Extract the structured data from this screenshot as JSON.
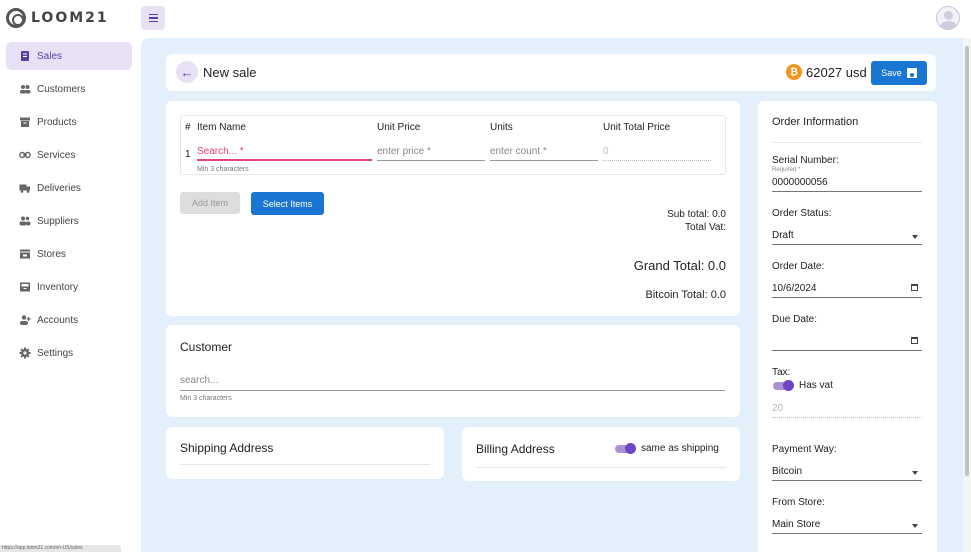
{
  "app": {
    "logo_text": "LOOM21"
  },
  "sidebar": {
    "items": [
      {
        "label": "Sales",
        "icon": "receipt-icon"
      },
      {
        "label": "Customers",
        "icon": "people-icon"
      },
      {
        "label": "Products",
        "icon": "archive-icon"
      },
      {
        "label": "Services",
        "icon": "link-icon"
      },
      {
        "label": "Deliveries",
        "icon": "truck-icon"
      },
      {
        "label": "Suppliers",
        "icon": "group-icon"
      },
      {
        "label": "Stores",
        "icon": "store-icon"
      },
      {
        "label": "Inventory",
        "icon": "inventory-icon"
      },
      {
        "label": "Accounts",
        "icon": "add-person-icon"
      },
      {
        "label": "Settings",
        "icon": "gear-icon"
      }
    ],
    "active": "Sales"
  },
  "status_url": "https://app.loom21.com/en-US/sales",
  "header": {
    "title": "New sale",
    "btc_price": "62027 usd",
    "save_label": "Save"
  },
  "items_table": {
    "columns": [
      "#",
      "Item Name",
      "Unit Price",
      "Units",
      "Unit Total Price"
    ],
    "row_number": "1",
    "item_placeholder": "Search... *",
    "item_helper": "Min 3 characters",
    "price_placeholder": "enter price *",
    "units_placeholder": "enter count *",
    "total_value": "0"
  },
  "actions": {
    "add_item": "Add Item",
    "select_items": "Select Items"
  },
  "totals": {
    "sub_total": "Sub total: 0.0",
    "total_vat": "Total Vat:",
    "grand_total": "Grand Total: 0.0",
    "bitcoin_total": "Bitcoin Total: 0.0"
  },
  "customer": {
    "title": "Customer",
    "search_placeholder": "search...",
    "helper": "Min 3 characters"
  },
  "shipping": {
    "title": "Shipping Address"
  },
  "billing": {
    "title": "Billing Address",
    "toggle_label": "same as shipping",
    "toggle_on": true
  },
  "order": {
    "title": "Order Information",
    "serial_label": "Serial Number:",
    "serial_required": "Required *",
    "serial_value": "0000000056",
    "status_label": "Order Status:",
    "status_value": "Draft",
    "order_date_label": "Order Date:",
    "order_date_value": "10/6/2024",
    "due_date_label": "Due Date:",
    "due_date_value": "",
    "tax_label": "Tax:",
    "has_vat_label": "Has vat",
    "has_vat_on": true,
    "vat_value": "20",
    "payment_label": "Payment Way:",
    "payment_value": "Bitcoin",
    "from_store_label": "From Store:",
    "from_store_value": "Main Store"
  },
  "colors": {
    "accent": "#5b3fa0",
    "accent_bg": "#e8e0f5",
    "primary_button": "#1976d2",
    "main_bg": "#e3effb",
    "bitcoin": "#f7931a",
    "required_field": "#e0457b"
  }
}
